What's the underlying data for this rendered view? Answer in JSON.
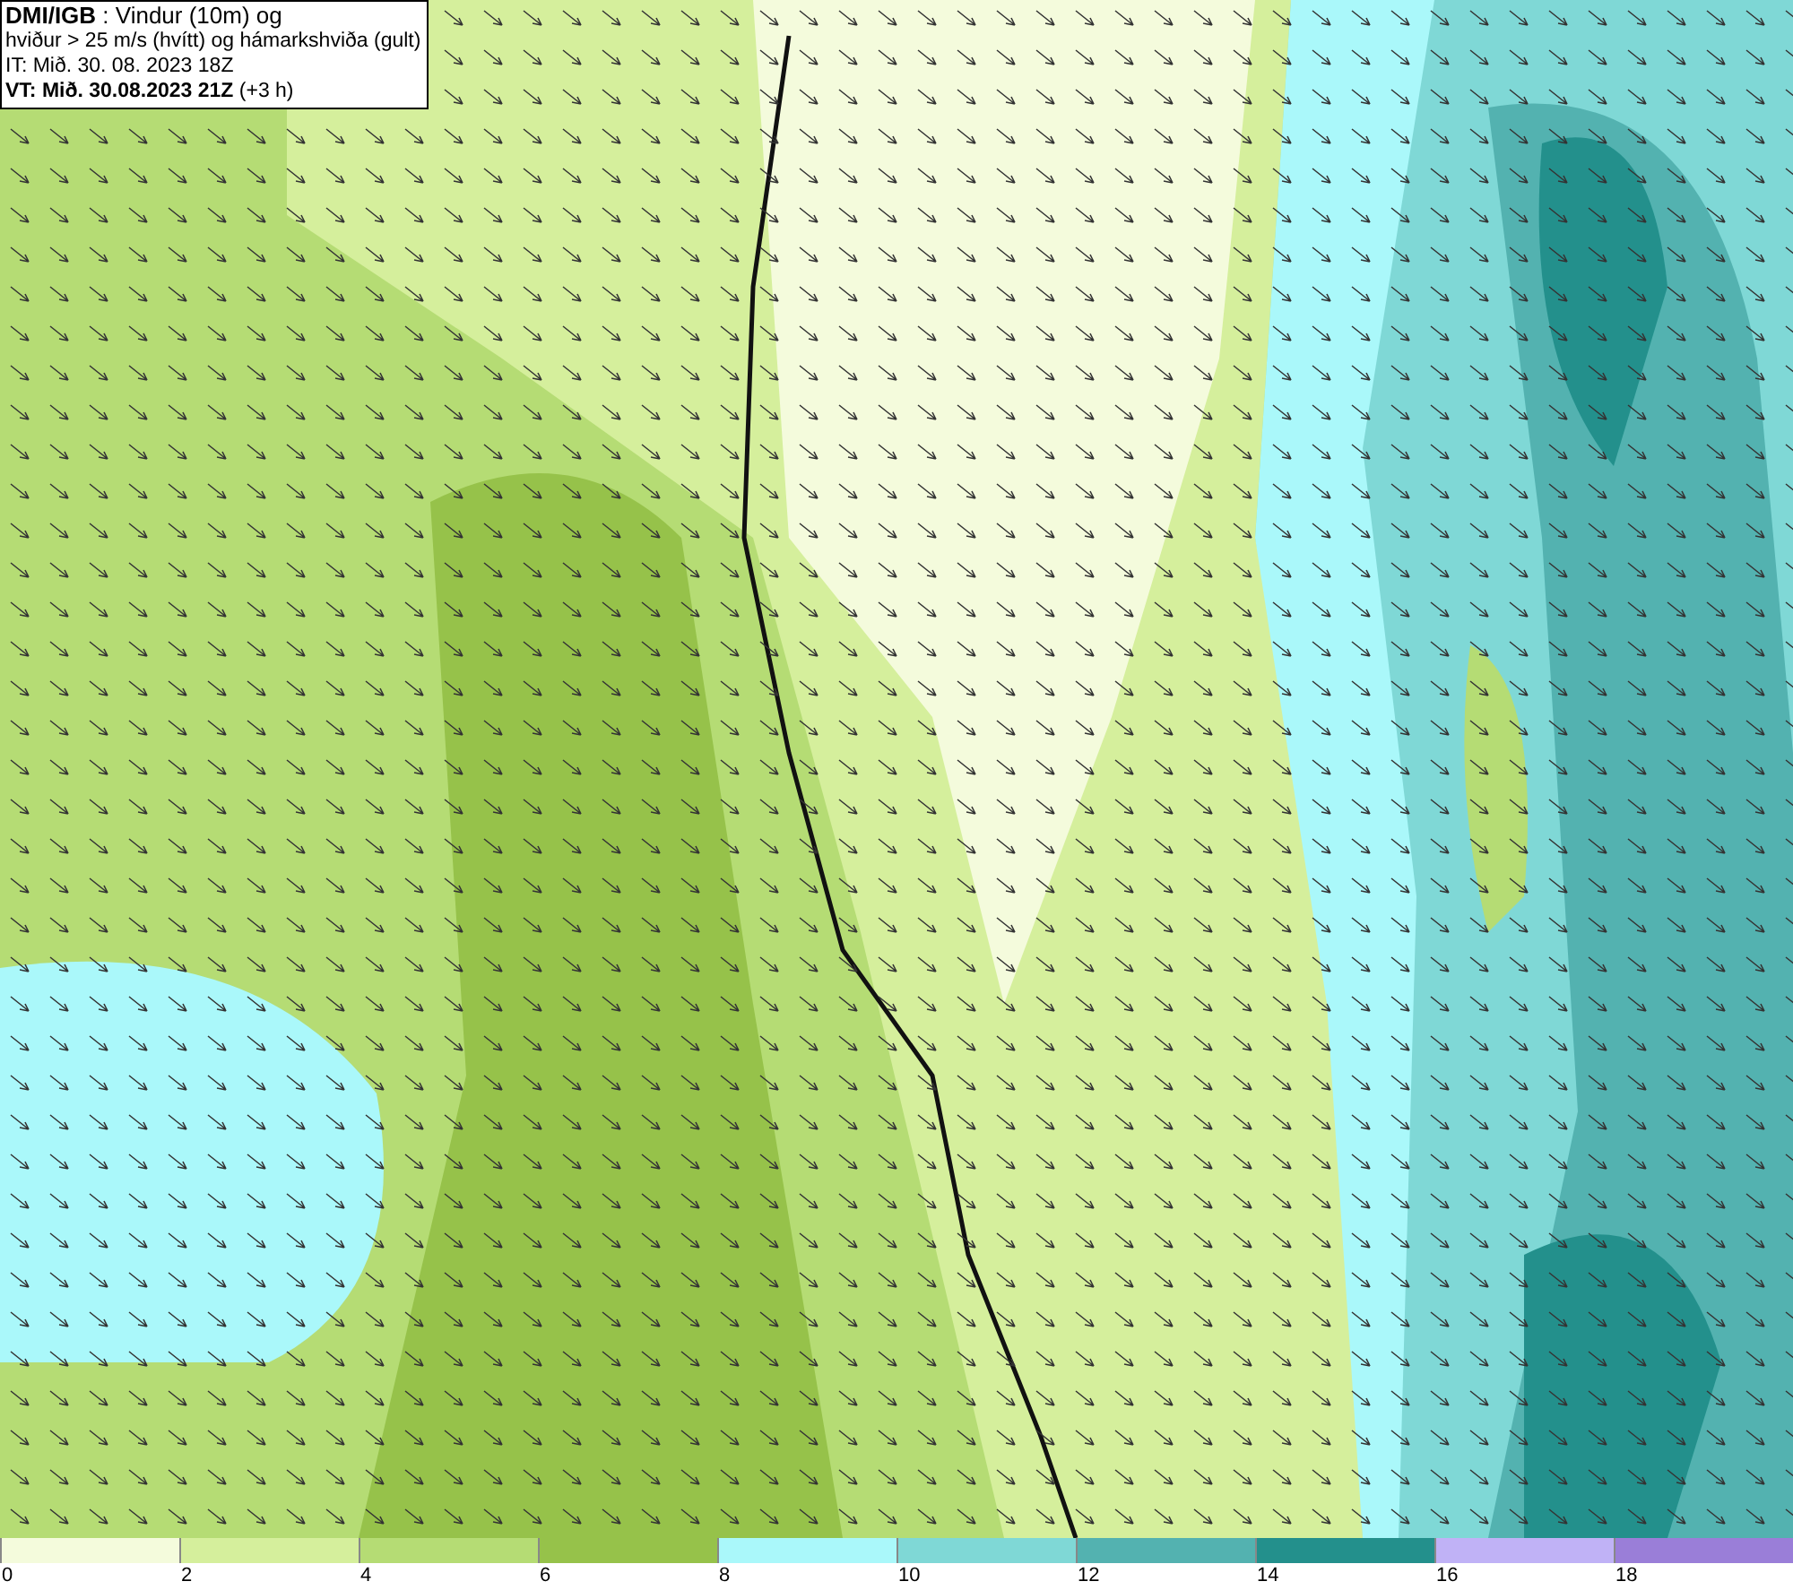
{
  "header": {
    "lines": [
      "**DMI/IGB** : Vindur (10m) og",
      "hviður > 25 m/s (hvítt) og hámarkshviða (gult)",
      "IT: Mið. 30. 08. 2023 18Z",
      "**VT: Mið. 30.08.2023 21Z** (+3 h)"
    ]
  },
  "legend": {
    "bins": [
      {
        "color": "#f4fbdc",
        "tick": "0"
      },
      {
        "color": "#d5ef9c",
        "tick": "2"
      },
      {
        "color": "#b5dc74",
        "tick": "4"
      },
      {
        "color": "#96c24a",
        "tick": "6"
      },
      {
        "color": "#aaf8fa",
        "tick": "8"
      },
      {
        "color": "#7fd8d6",
        "tick": "10"
      },
      {
        "color": "#53b2b0",
        "tick": "12"
      },
      {
        "color": "#23908c",
        "tick": "14"
      },
      {
        "color": "#c0b2f6",
        "tick": "16"
      },
      {
        "color": "#9a7ed8",
        "tick": "18"
      }
    ]
  }
}
